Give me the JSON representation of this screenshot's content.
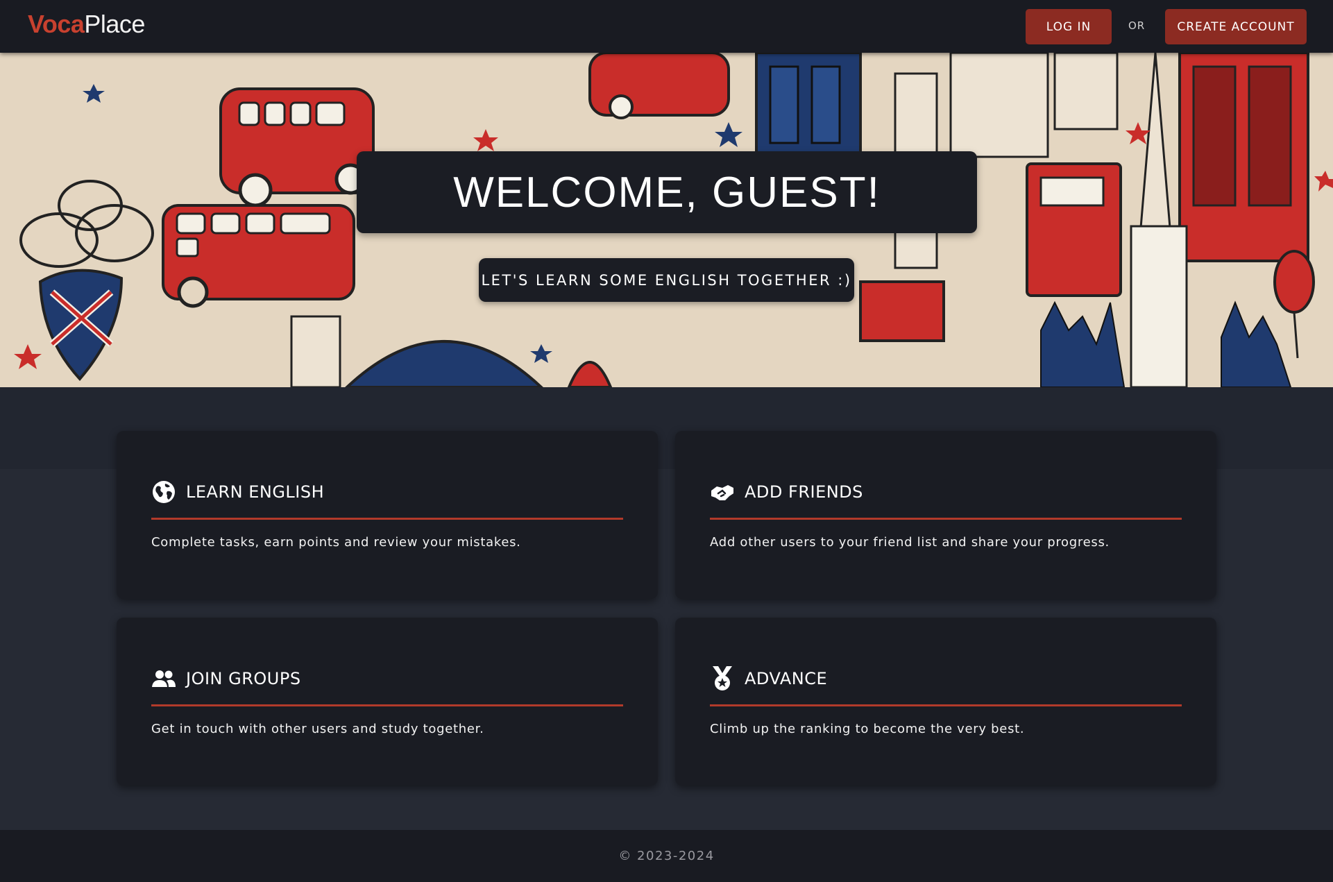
{
  "brand": {
    "part1": "Voca",
    "part2": "Place"
  },
  "nav": {
    "login_label": "LOG IN",
    "or_label": "OR",
    "create_account_label": "CREATE ACCOUNT"
  },
  "hero": {
    "title": "WELCOME, GUEST!",
    "tagline": "LET'S LEARN SOME ENGLISH TOGETHER :)"
  },
  "features": [
    {
      "icon": "globe-icon",
      "title": "LEARN ENGLISH",
      "text": "Complete tasks, earn points and review your mistakes."
    },
    {
      "icon": "handshake-icon",
      "title": "ADD FRIENDS",
      "text": "Add other users to your friend list and share your progress."
    },
    {
      "icon": "users-icon",
      "title": "JOIN GROUPS",
      "text": "Get in touch with other users and study together."
    },
    {
      "icon": "medal-icon",
      "title": "ADVANCE",
      "text": "Climb up the ranking to become the very best."
    }
  ],
  "footer": {
    "copyright": "© 2023-2024"
  },
  "colors": {
    "accent": "#8c2b22",
    "brand_red": "#c8412f",
    "rule": "#b23a2a",
    "navbar": "#191b22",
    "card": "#1a1c23",
    "page": "#262a34"
  }
}
